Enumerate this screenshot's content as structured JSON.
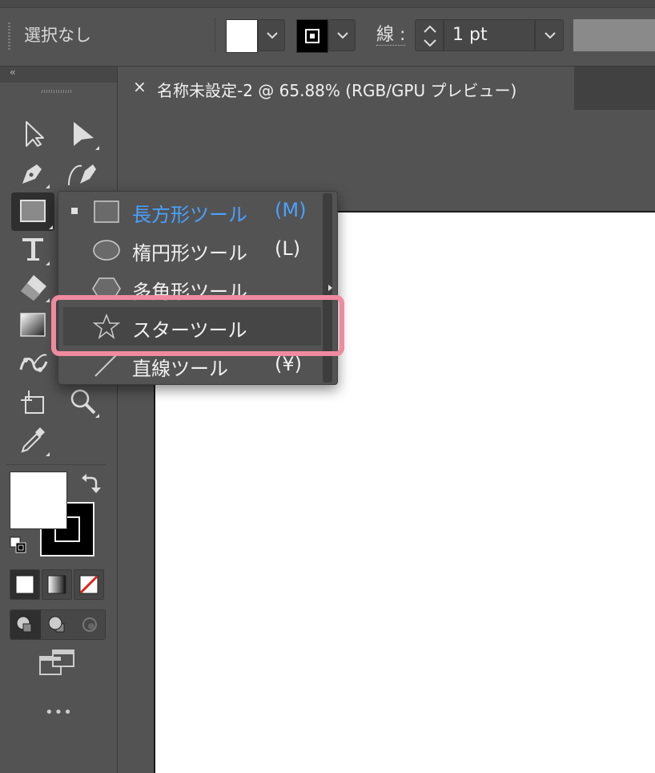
{
  "control_bar": {
    "selection_label": "選択なし",
    "stroke_label": "線 :",
    "stroke_value": "1 pt"
  },
  "document_tab": {
    "close_glyph": "×",
    "title": "名称未設定-2 @ 65.88% (RGB/GPU プレビュー)"
  },
  "tools_panel": {
    "collapse_glyph": "‹‹",
    "tools": [
      "selection-tool",
      "direct-selection-tool",
      "pen-tool",
      "curvature-tool",
      "rectangle-tool",
      "type-tool",
      "eraser-tool",
      "gradient-tool",
      "puppet-warp-tool",
      "artboard-tool",
      "zoom-tool",
      "eyedropper-tool"
    ],
    "more_label": "•••"
  },
  "flyout": {
    "items": [
      {
        "label": "長方形ツール",
        "shortcut": "(M)",
        "icon": "rectangle-icon",
        "active": true
      },
      {
        "label": "楕円形ツール",
        "shortcut": "(L)",
        "icon": "ellipse-icon",
        "active": false
      },
      {
        "label": "多角形ツール",
        "shortcut": "",
        "icon": "polygon-icon",
        "active": false
      },
      {
        "label": "スターツール",
        "shortcut": "",
        "icon": "star-icon",
        "active": false,
        "highlighted": true
      },
      {
        "label": "直線ツール",
        "shortcut": "(¥)",
        "icon": "line-icon",
        "active": false
      }
    ]
  },
  "colors": {
    "accent": "#4aa1ff",
    "highlight": "#f08aa0",
    "fill": "#ffffff",
    "stroke": "#000000"
  }
}
